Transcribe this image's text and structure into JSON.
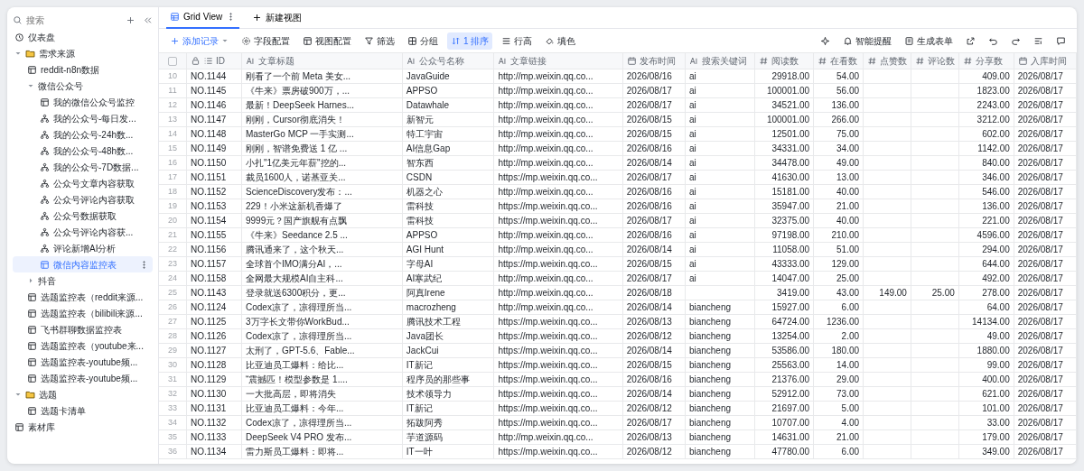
{
  "sidebar": {
    "search": {
      "placeholder": "搜索"
    },
    "items": [
      {
        "label": "仪表盘",
        "kind": "dashboard",
        "selected": false
      },
      {
        "label": "需求来源",
        "kind": "folder",
        "expanded": true,
        "selected": false,
        "children": [
          {
            "label": "reddit-n8n数据",
            "kind": "table",
            "selected": false
          },
          {
            "label": "微信公众号",
            "kind": "group",
            "expanded": true,
            "selected": false,
            "children": [
              {
                "label": "我的微信公众号监控",
                "kind": "table",
                "selected": false
              },
              {
                "label": "我的公众号-每日发...",
                "kind": "flow",
                "selected": false
              },
              {
                "label": "我的公众号-24h数...",
                "kind": "flow",
                "selected": false
              },
              {
                "label": "我的公众号-48h数...",
                "kind": "flow",
                "selected": false
              },
              {
                "label": "我的公众号-7D数据...",
                "kind": "flow",
                "selected": false
              },
              {
                "label": "公众号文章内容获取",
                "kind": "flow",
                "selected": false
              },
              {
                "label": "公众号评论内容获取",
                "kind": "flow",
                "selected": false
              },
              {
                "label": "公众号数据获取",
                "kind": "flow",
                "selected": false
              },
              {
                "label": "公众号评论内容获...",
                "kind": "flow",
                "selected": false
              },
              {
                "label": "评论新增AI分析",
                "kind": "flow",
                "selected": false
              },
              {
                "label": "微信内容监控表",
                "kind": "table",
                "selected": true
              }
            ]
          },
          {
            "label": "抖音",
            "kind": "group",
            "expanded": false,
            "selected": false
          },
          {
            "label": "选题监控表（reddit来源...",
            "kind": "table",
            "selected": false
          },
          {
            "label": "选题监控表（bilibili来源...",
            "kind": "table",
            "selected": false
          },
          {
            "label": "飞书群聊数据监控表",
            "kind": "table",
            "selected": false
          },
          {
            "label": "选题监控表（youtube来...",
            "kind": "table",
            "selected": false
          },
          {
            "label": "选题监控表-youtube频...",
            "kind": "table",
            "selected": false
          },
          {
            "label": "选题监控表-youtube频...",
            "kind": "table",
            "selected": false
          }
        ]
      },
      {
        "label": "选题",
        "kind": "folder",
        "expanded": true,
        "selected": false,
        "children": [
          {
            "label": "选题卡清单",
            "kind": "table",
            "selected": false
          }
        ]
      },
      {
        "label": "素材库",
        "kind": "table",
        "selected": false
      }
    ]
  },
  "tabs": [
    {
      "label": "Grid View",
      "selected": true
    }
  ],
  "new_view_button": {
    "label": "新建视图"
  },
  "toolbar": {
    "left": [
      {
        "label": "添加记录",
        "kind": "plus",
        "active": false
      },
      {
        "label": "字段配置",
        "kind": "gear",
        "active": false
      },
      {
        "label": "视图配置",
        "kind": "layout",
        "active": false
      },
      {
        "label": "筛选",
        "kind": "filter",
        "active": false
      },
      {
        "label": "分组",
        "kind": "group",
        "active": false
      },
      {
        "label": "1 排序",
        "kind": "sort",
        "active": true
      },
      {
        "label": "行高",
        "kind": "rows",
        "active": false
      },
      {
        "label": "填色",
        "kind": "paint",
        "active": false
      }
    ],
    "right": [
      {
        "kind": "sparkle"
      },
      {
        "label": "智能提醒",
        "kind": "bell"
      },
      {
        "label": "生成表单",
        "kind": "form"
      },
      {
        "kind": "share"
      },
      {
        "kind": "undo"
      },
      {
        "kind": "redo"
      },
      {
        "kind": "panel"
      },
      {
        "kind": "comment"
      }
    ]
  },
  "table": {
    "all_selected": false,
    "columns": [
      {
        "label": "ID",
        "kind": "id"
      },
      {
        "label": "文章标题",
        "kind": "text"
      },
      {
        "label": "公众号名称",
        "kind": "text"
      },
      {
        "label": "文章链接",
        "kind": "text"
      },
      {
        "label": "发布时间",
        "kind": "date"
      },
      {
        "label": "搜索关键词",
        "kind": "text"
      },
      {
        "label": "阅读数",
        "kind": "number"
      },
      {
        "label": "在看数",
        "kind": "number"
      },
      {
        "label": "点赞数",
        "kind": "number"
      },
      {
        "label": "评论数",
        "kind": "number"
      },
      {
        "label": "分享数",
        "kind": "number"
      },
      {
        "label": "入库时间",
        "kind": "date"
      }
    ],
    "rows": [
      {
        "n": "10",
        "cells": [
          "NO.1144",
          "刚看了一个前 Meta 美女...",
          "JavaGuide",
          "http://mp.weixin.qq.co...",
          "2026/08/16",
          "ai",
          "29918.00",
          "54.00",
          null,
          null,
          "409.00",
          "2026/08/17"
        ]
      },
      {
        "n": "11",
        "cells": [
          "NO.1145",
          "《牛来》票房破900万，...",
          "APPSO",
          "http://mp.weixin.qq.co...",
          "2026/08/17",
          "ai",
          "100001.00",
          "56.00",
          null,
          null,
          "1823.00",
          "2026/08/17"
        ]
      },
      {
        "n": "12",
        "cells": [
          "NO.1146",
          "最新！DeepSeek Harnes...",
          "Datawhale",
          "http://mp.weixin.qq.co...",
          "2026/08/17",
          "ai",
          "34521.00",
          "136.00",
          null,
          null,
          "2243.00",
          "2026/08/17"
        ]
      },
      {
        "n": "13",
        "cells": [
          "NO.1147",
          "刚刚，Cursor彻底消失！",
          "新智元",
          "http://mp.weixin.qq.co...",
          "2026/08/15",
          "ai",
          "100001.00",
          "266.00",
          null,
          null,
          "3212.00",
          "2026/08/17"
        ]
      },
      {
        "n": "14",
        "cells": [
          "NO.1148",
          "MasterGo MCP 一手实测...",
          "特工宇宙",
          "http://mp.weixin.qq.co...",
          "2026/08/15",
          "ai",
          "12501.00",
          "75.00",
          null,
          null,
          "602.00",
          "2026/08/17"
        ]
      },
      {
        "n": "15",
        "cells": [
          "NO.1149",
          "刚刚，智谱免费送 1 亿 ...",
          "AI信息Gap",
          "http://mp.weixin.qq.co...",
          "2026/08/16",
          "ai",
          "34331.00",
          "34.00",
          null,
          null,
          "1142.00",
          "2026/08/17"
        ]
      },
      {
        "n": "16",
        "cells": [
          "NO.1150",
          "小扎\"1亿美元年薪\"挖的...",
          "智东西",
          "http://mp.weixin.qq.co...",
          "2026/08/14",
          "ai",
          "34478.00",
          "49.00",
          null,
          null,
          "840.00",
          "2026/08/17"
        ]
      },
      {
        "n": "17",
        "cells": [
          "NO.1151",
          "裁员1600人，诺基亚关...",
          "CSDN",
          "https://mp.weixin.qq.co...",
          "2026/08/17",
          "ai",
          "41630.00",
          "13.00",
          null,
          null,
          "346.00",
          "2026/08/17"
        ]
      },
      {
        "n": "18",
        "cells": [
          "NO.1152",
          "ScienceDiscovery发布：...",
          "机器之心",
          "http://mp.weixin.qq.co...",
          "2026/08/16",
          "ai",
          "15181.00",
          "40.00",
          null,
          null,
          "546.00",
          "2026/08/17"
        ]
      },
      {
        "n": "19",
        "cells": [
          "NO.1153",
          "229！小米这新机香爆了",
          "雷科技",
          "https://mp.weixin.qq.co...",
          "2026/08/16",
          "ai",
          "35947.00",
          "21.00",
          null,
          null,
          "136.00",
          "2026/08/17"
        ]
      },
      {
        "n": "20",
        "cells": [
          "NO.1154",
          "9999元？国产旗舰有点飘",
          "雷科技",
          "https://mp.weixin.qq.co...",
          "2026/08/17",
          "ai",
          "32375.00",
          "40.00",
          null,
          null,
          "221.00",
          "2026/08/17"
        ]
      },
      {
        "n": "21",
        "cells": [
          "NO.1155",
          "《牛来》Seedance 2.5 ...",
          "APPSO",
          "http://mp.weixin.qq.co...",
          "2026/08/16",
          "ai",
          "97198.00",
          "210.00",
          null,
          null,
          "4596.00",
          "2026/08/17"
        ]
      },
      {
        "n": "22",
        "cells": [
          "NO.1156",
          "腾讯通来了，这个秋天...",
          "AGI Hunt",
          "http://mp.weixin.qq.co...",
          "2026/08/14",
          "ai",
          "11058.00",
          "51.00",
          null,
          null,
          "294.00",
          "2026/08/17"
        ]
      },
      {
        "n": "23",
        "cells": [
          "NO.1157",
          "全球首个IMO满分AI，...",
          "字母AI",
          "https://mp.weixin.qq.co...",
          "2026/08/15",
          "ai",
          "43333.00",
          "129.00",
          null,
          null,
          "644.00",
          "2026/08/17"
        ]
      },
      {
        "n": "24",
        "cells": [
          "NO.1158",
          "全网最大规模AI自主科...",
          "AI寒武纪",
          "http://mp.weixin.qq.co...",
          "2026/08/17",
          "ai",
          "14047.00",
          "25.00",
          null,
          null,
          "492.00",
          "2026/08/17"
        ]
      },
      {
        "n": "25",
        "cells": [
          "NO.1143",
          "登录就送6300积分，更...",
          "阿真Irene",
          "http://mp.weixin.qq.co...",
          "2026/08/18",
          null,
          "3419.00",
          "43.00",
          "149.00",
          "25.00",
          "278.00",
          "2026/08/17"
        ]
      },
      {
        "n": "26",
        "cells": [
          "NO.1124",
          "Codex凉了，凉得理所当...",
          "macrozheng",
          "http://mp.weixin.qq.co...",
          "2026/08/14",
          "biancheng",
          "15927.00",
          "6.00",
          null,
          null,
          "64.00",
          "2026/08/17"
        ]
      },
      {
        "n": "27",
        "cells": [
          "NO.1125",
          "3万字长文带你WorkBud...",
          "腾讯技术工程",
          "https://mp.weixin.qq.co...",
          "2026/08/13",
          "biancheng",
          "64724.00",
          "1236.00",
          null,
          null,
          "14134.00",
          "2026/08/17"
        ]
      },
      {
        "n": "28",
        "cells": [
          "NO.1126",
          "Codex凉了，凉得理所当...",
          "Java团长",
          "https://mp.weixin.qq.co...",
          "2026/08/12",
          "biancheng",
          "13254.00",
          "2.00",
          null,
          null,
          "49.00",
          "2026/08/17"
        ]
      },
      {
        "n": "29",
        "cells": [
          "NO.1127",
          "太刑了，GPT-5.6、Fable...",
          "JackCui",
          "https://mp.weixin.qq.co...",
          "2026/08/14",
          "biancheng",
          "53586.00",
          "180.00",
          null,
          null,
          "1880.00",
          "2026/08/17"
        ]
      },
      {
        "n": "30",
        "cells": [
          "NO.1128",
          "比亚迪员工爆料：给比...",
          "IT新记",
          "https://mp.weixin.qq.co...",
          "2026/08/15",
          "biancheng",
          "25563.00",
          "14.00",
          null,
          null,
          "99.00",
          "2026/08/17"
        ]
      },
      {
        "n": "31",
        "cells": [
          "NO.1129",
          "“震撼匹！模型参数是 1....",
          "程序员的那些事",
          "https://mp.weixin.qq.co...",
          "2026/08/16",
          "biancheng",
          "21376.00",
          "29.00",
          null,
          null,
          "400.00",
          "2026/08/17"
        ]
      },
      {
        "n": "32",
        "cells": [
          "NO.1130",
          "一大批高层，即将消失",
          "技术领导力",
          "https://mp.weixin.qq.co...",
          "2026/08/14",
          "biancheng",
          "52912.00",
          "73.00",
          null,
          null,
          "621.00",
          "2026/08/17"
        ]
      },
      {
        "n": "33",
        "cells": [
          "NO.1131",
          "比亚迪员工爆料：今年...",
          "IT新记",
          "https://mp.weixin.qq.co...",
          "2026/08/12",
          "biancheng",
          "21697.00",
          "5.00",
          null,
          null,
          "101.00",
          "2026/08/17"
        ]
      },
      {
        "n": "34",
        "cells": [
          "NO.1132",
          "Codex凉了，凉得理所当...",
          "拓跋阿秀",
          "https://mp.weixin.qq.co...",
          "2026/08/17",
          "biancheng",
          "10707.00",
          "4.00",
          null,
          null,
          "33.00",
          "2026/08/17"
        ]
      },
      {
        "n": "35",
        "cells": [
          "NO.1133",
          "DeepSeek V4 PRO 发布...",
          "芋道源码",
          "http://mp.weixin.qq.co...",
          "2026/08/13",
          "biancheng",
          "14631.00",
          "21.00",
          null,
          null,
          "179.00",
          "2026/08/17"
        ]
      },
      {
        "n": "36",
        "cells": [
          "NO.1134",
          "雷力斯员工爆料：即将...",
          "IT一叶",
          "https://mp.weixin.qq.co...",
          "2026/08/12",
          "biancheng",
          "47780.00",
          "6.00",
          null,
          null,
          "349.00",
          "2026/08/17"
        ]
      }
    ]
  }
}
